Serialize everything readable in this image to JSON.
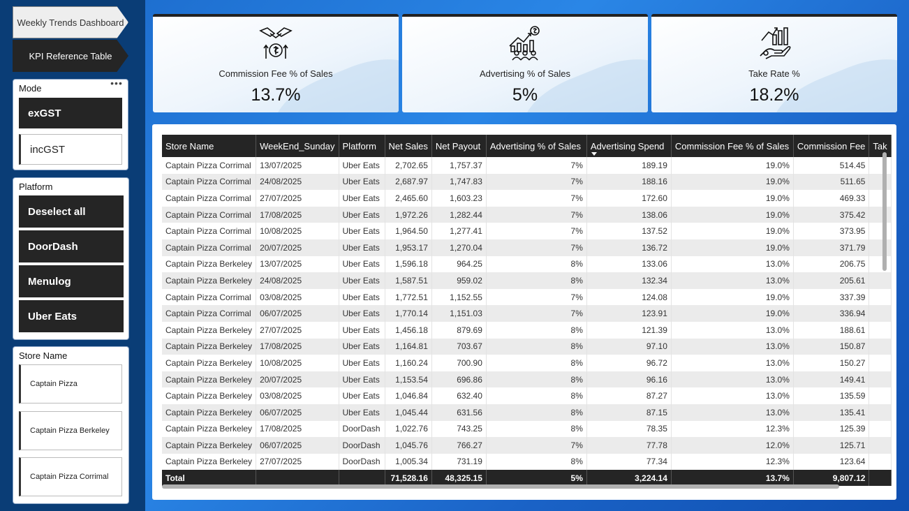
{
  "nav": {
    "weekly_trends": "Weekly Trends Dashboard",
    "kpi_reference": "KPI Reference Table"
  },
  "mode_slicer": {
    "title": "Mode",
    "options": [
      "exGST",
      "incGST"
    ]
  },
  "platform_slicer": {
    "title": "Platform",
    "options": [
      "Deselect all",
      "DoorDash",
      "Menulog",
      "Uber Eats"
    ]
  },
  "store_slicer": {
    "title": "Store Name",
    "options": [
      "Captain Pizza",
      "Captain Pizza Berkeley",
      "Captain Pizza Corrimal"
    ]
  },
  "kpi_cards": [
    {
      "label": "Commission Fee % of Sales",
      "value": "13.7%",
      "icon": "handshake-money-icon"
    },
    {
      "label": "Advertising % of Sales",
      "value": "5%",
      "icon": "growth-audience-icon"
    },
    {
      "label": "Take Rate %",
      "value": "18.2%",
      "icon": "hand-growth-chart-icon"
    }
  ],
  "table": {
    "headers": [
      "Store Name",
      "WeekEnd_Sunday",
      "Platform",
      "Net Sales",
      "Net Payout",
      "Advertising % of Sales",
      "Advertising Spend",
      "Commission Fee % of Sales",
      "Commission Fee",
      "Tak"
    ],
    "rows": [
      [
        "Captain Pizza Corrimal",
        "13/07/2025",
        "Uber Eats",
        "2,702.65",
        "1,757.37",
        "7%",
        "189.19",
        "19.0%",
        "514.45"
      ],
      [
        "Captain Pizza Corrimal",
        "24/08/2025",
        "Uber Eats",
        "2,687.97",
        "1,747.83",
        "7%",
        "188.16",
        "19.0%",
        "511.65"
      ],
      [
        "Captain Pizza Corrimal",
        "27/07/2025",
        "Uber Eats",
        "2,465.60",
        "1,603.23",
        "7%",
        "172.60",
        "19.0%",
        "469.33"
      ],
      [
        "Captain Pizza Corrimal",
        "17/08/2025",
        "Uber Eats",
        "1,972.26",
        "1,282.44",
        "7%",
        "138.06",
        "19.0%",
        "375.42"
      ],
      [
        "Captain Pizza Corrimal",
        "10/08/2025",
        "Uber Eats",
        "1,964.50",
        "1,277.41",
        "7%",
        "137.52",
        "19.0%",
        "373.95"
      ],
      [
        "Captain Pizza Corrimal",
        "20/07/2025",
        "Uber Eats",
        "1,953.17",
        "1,270.04",
        "7%",
        "136.72",
        "19.0%",
        "371.79"
      ],
      [
        "Captain Pizza Berkeley",
        "13/07/2025",
        "Uber Eats",
        "1,596.18",
        "964.25",
        "8%",
        "133.06",
        "13.0%",
        "206.75"
      ],
      [
        "Captain Pizza Berkeley",
        "24/08/2025",
        "Uber Eats",
        "1,587.51",
        "959.02",
        "8%",
        "132.34",
        "13.0%",
        "205.61"
      ],
      [
        "Captain Pizza Corrimal",
        "03/08/2025",
        "Uber Eats",
        "1,772.51",
        "1,152.55",
        "7%",
        "124.08",
        "19.0%",
        "337.39"
      ],
      [
        "Captain Pizza Corrimal",
        "06/07/2025",
        "Uber Eats",
        "1,770.14",
        "1,151.03",
        "7%",
        "123.91",
        "19.0%",
        "336.94"
      ],
      [
        "Captain Pizza Berkeley",
        "27/07/2025",
        "Uber Eats",
        "1,456.18",
        "879.69",
        "8%",
        "121.39",
        "13.0%",
        "188.61"
      ],
      [
        "Captain Pizza Berkeley",
        "17/08/2025",
        "Uber Eats",
        "1,164.81",
        "703.67",
        "8%",
        "97.10",
        "13.0%",
        "150.87"
      ],
      [
        "Captain Pizza Berkeley",
        "10/08/2025",
        "Uber Eats",
        "1,160.24",
        "700.90",
        "8%",
        "96.72",
        "13.0%",
        "150.27"
      ],
      [
        "Captain Pizza Berkeley",
        "20/07/2025",
        "Uber Eats",
        "1,153.54",
        "696.86",
        "8%",
        "96.16",
        "13.0%",
        "149.41"
      ],
      [
        "Captain Pizza Berkeley",
        "03/08/2025",
        "Uber Eats",
        "1,046.84",
        "632.40",
        "8%",
        "87.27",
        "13.0%",
        "135.59"
      ],
      [
        "Captain Pizza Berkeley",
        "06/07/2025",
        "Uber Eats",
        "1,045.44",
        "631.56",
        "8%",
        "87.15",
        "13.0%",
        "135.41"
      ],
      [
        "Captain Pizza Berkeley",
        "17/08/2025",
        "DoorDash",
        "1,022.76",
        "743.25",
        "8%",
        "78.35",
        "12.3%",
        "125.39"
      ],
      [
        "Captain Pizza Berkeley",
        "06/07/2025",
        "DoorDash",
        "1,045.76",
        "766.27",
        "7%",
        "77.78",
        "12.0%",
        "125.71"
      ],
      [
        "Captain Pizza Berkeley",
        "27/07/2025",
        "DoorDash",
        "1,005.34",
        "731.19",
        "8%",
        "77.34",
        "12.3%",
        "123.64"
      ]
    ],
    "total": [
      "Total",
      "",
      "",
      "71,528.16",
      "48,325.15",
      "5%",
      "3,224.14",
      "13.7%",
      "9,807.12",
      ""
    ]
  },
  "colors": {
    "header_bg": "#252525",
    "main_bg": "#2a86e6",
    "sidebar_bg": "#0a3d76"
  }
}
